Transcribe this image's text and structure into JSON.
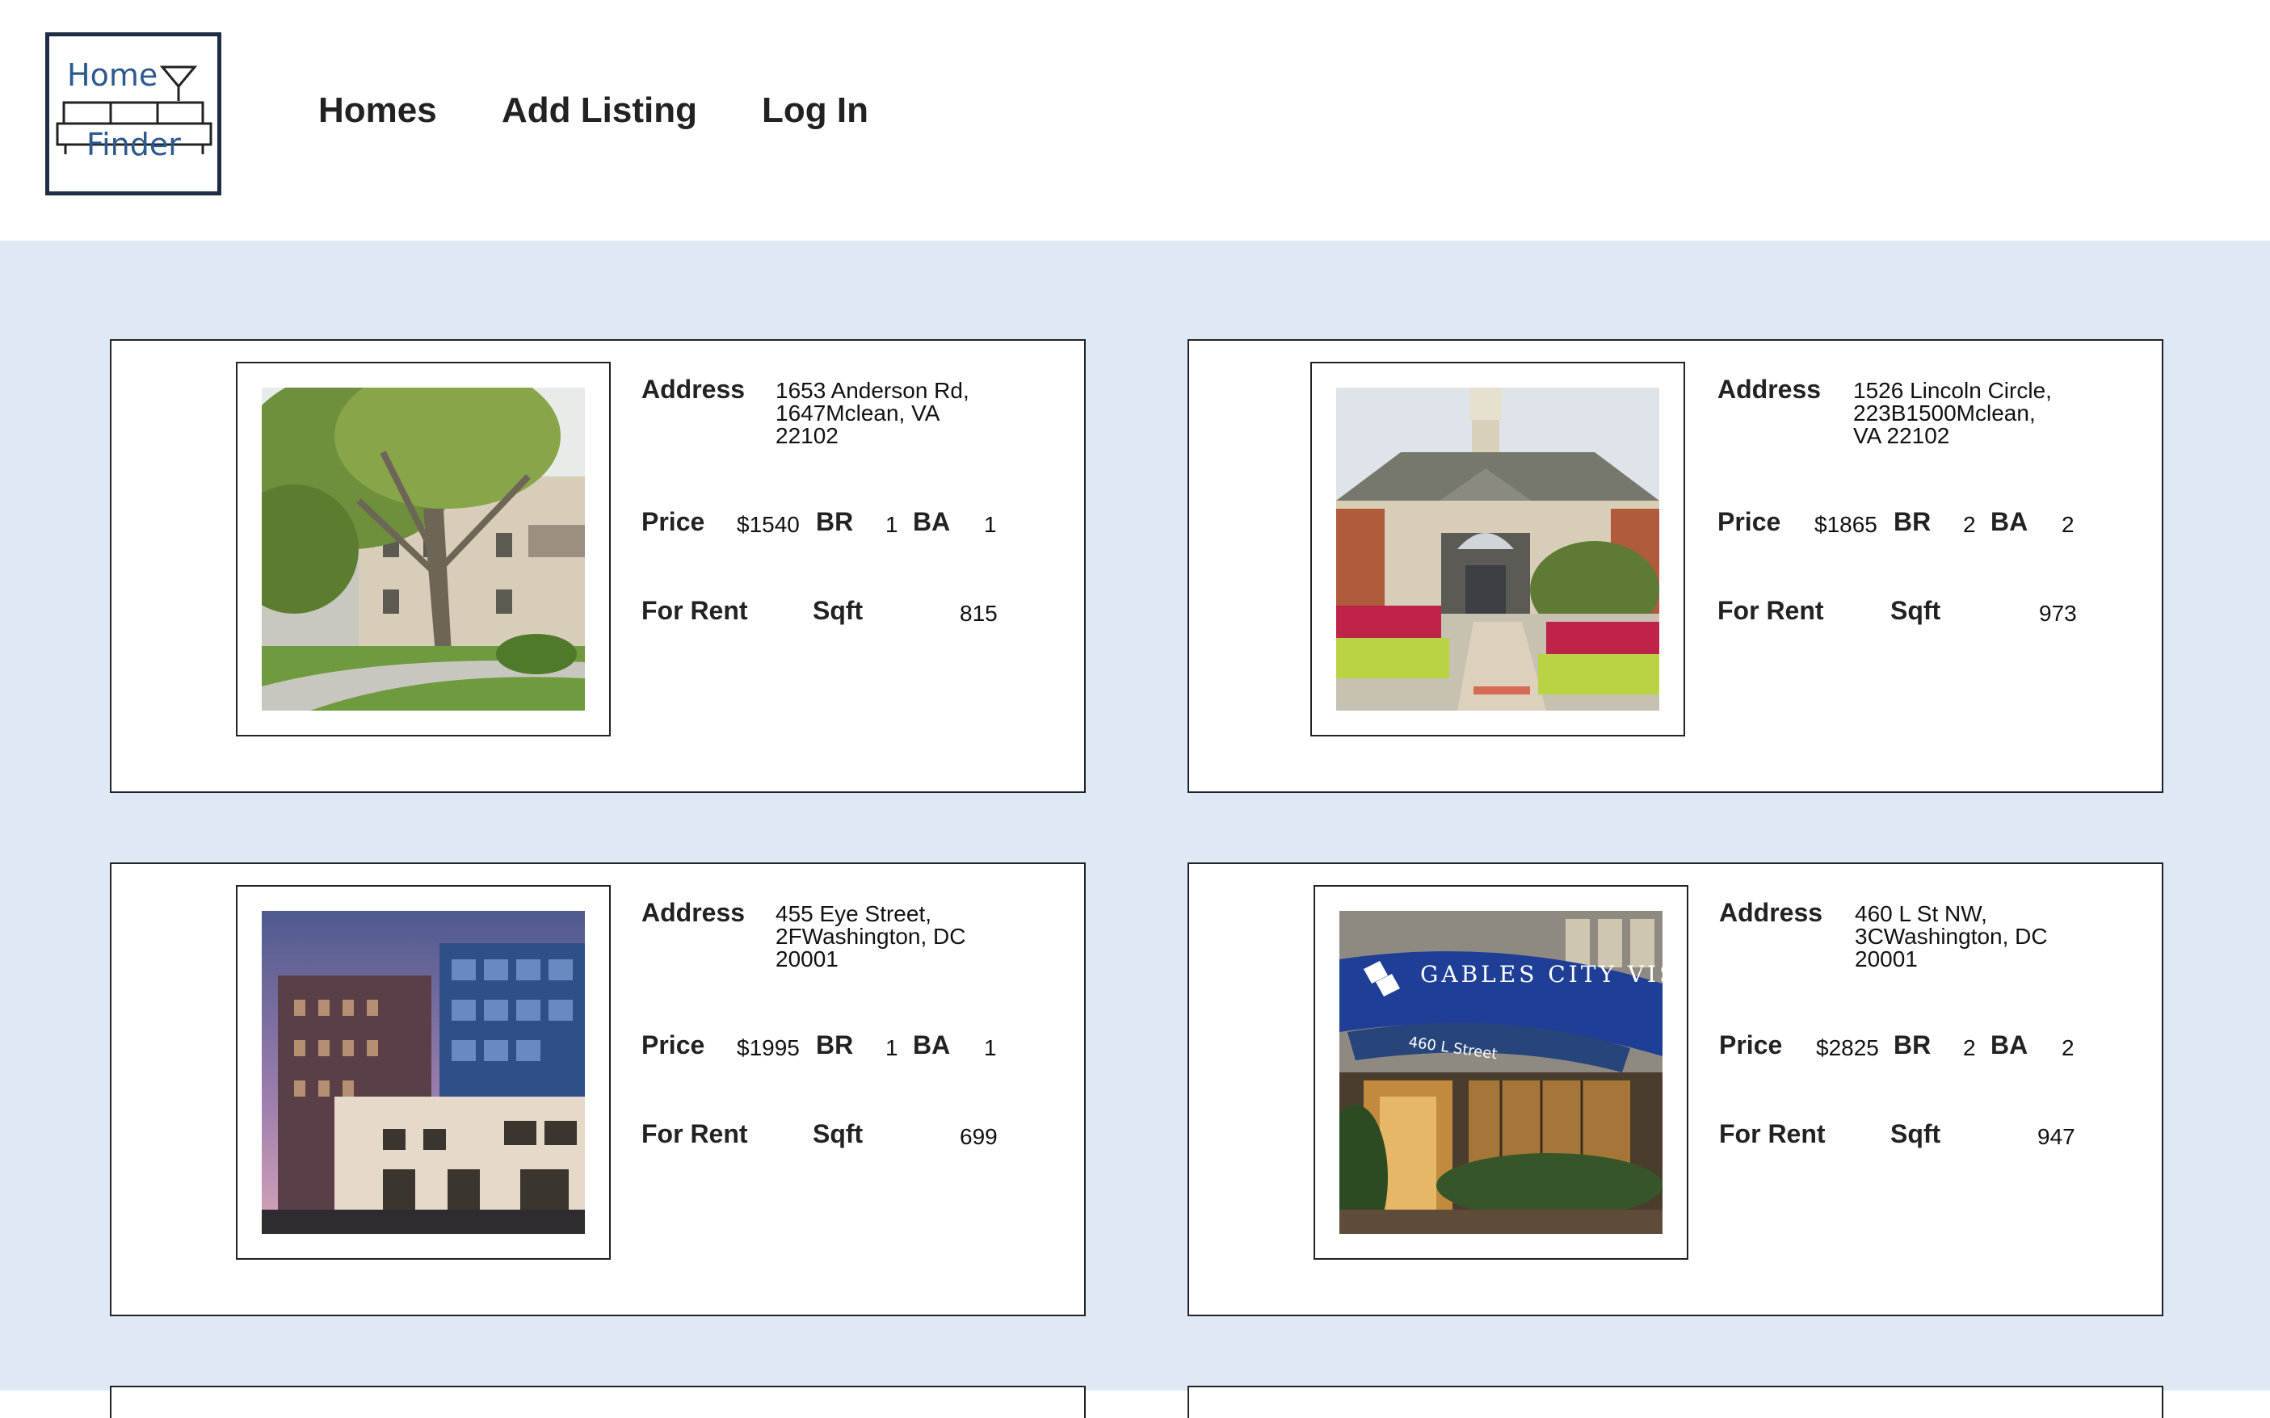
{
  "header": {
    "logo": {
      "line1": "Home",
      "line2": "Finder"
    },
    "nav": [
      {
        "label": "Homes"
      },
      {
        "label": "Add Listing"
      },
      {
        "label": "Log In"
      }
    ]
  },
  "colors": {
    "background": "#dfe9f6",
    "logo_text": "#2c5a8e",
    "logo_border": "#1f2d44"
  },
  "labels": {
    "address": "Address",
    "price": "Price",
    "br": "BR",
    "ba": "BA",
    "sqft": "Sqft"
  },
  "listings": [
    {
      "image": "apartment-trees-photo",
      "address": "1653 Anderson Rd, 1647Mclean, VA 22102",
      "price": "$1540",
      "br": "1",
      "ba": "1",
      "status": "For Rent",
      "sqft": "815"
    },
    {
      "image": "clubhouse-photo",
      "address": "1526 Lincoln Circle, 223B1500Mclean, VA 22102",
      "price": "$1865",
      "br": "2",
      "ba": "2",
      "status": "For Rent",
      "sqft": "973"
    },
    {
      "image": "modern-building-dusk-photo",
      "address": "455 Eye Street, 2FWashington, DC 20001",
      "price": "$1995",
      "br": "1",
      "ba": "1",
      "status": "For Rent",
      "sqft": "699"
    },
    {
      "image": "gables-city-vista-photo",
      "address": "460 L St NW, 3CWashington, DC 20001",
      "price": "$2825",
      "br": "2",
      "ba": "2",
      "status": "For Rent",
      "sqft": "947"
    }
  ],
  "photo_signage": {
    "canopy": "GABLES CITY VISTA",
    "street": "460 L Street"
  }
}
